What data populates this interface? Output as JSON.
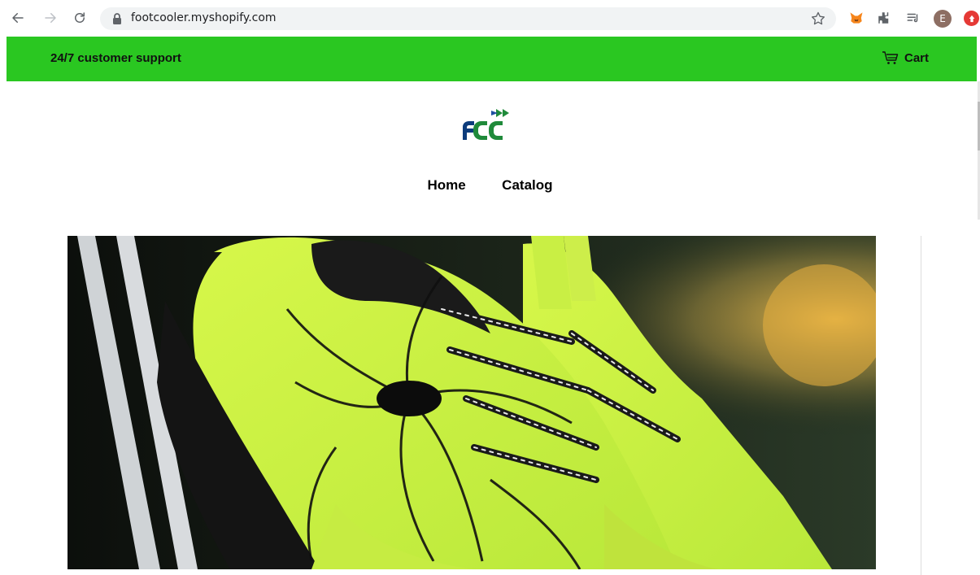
{
  "browser": {
    "url": "footcooler.myshopify.com",
    "profile_initial": "E"
  },
  "store": {
    "announcement": "24/7 customer support",
    "cart_label": "Cart",
    "logo_text": "FCC",
    "nav": [
      {
        "label": "Home"
      },
      {
        "label": "Catalog"
      }
    ]
  },
  "colors": {
    "announcement_bg": "#2ac721",
    "logo_blue": "#0d3c7c",
    "logo_green": "#1f8a3a"
  },
  "hero": {
    "icon": "sneaker-banner-image"
  }
}
